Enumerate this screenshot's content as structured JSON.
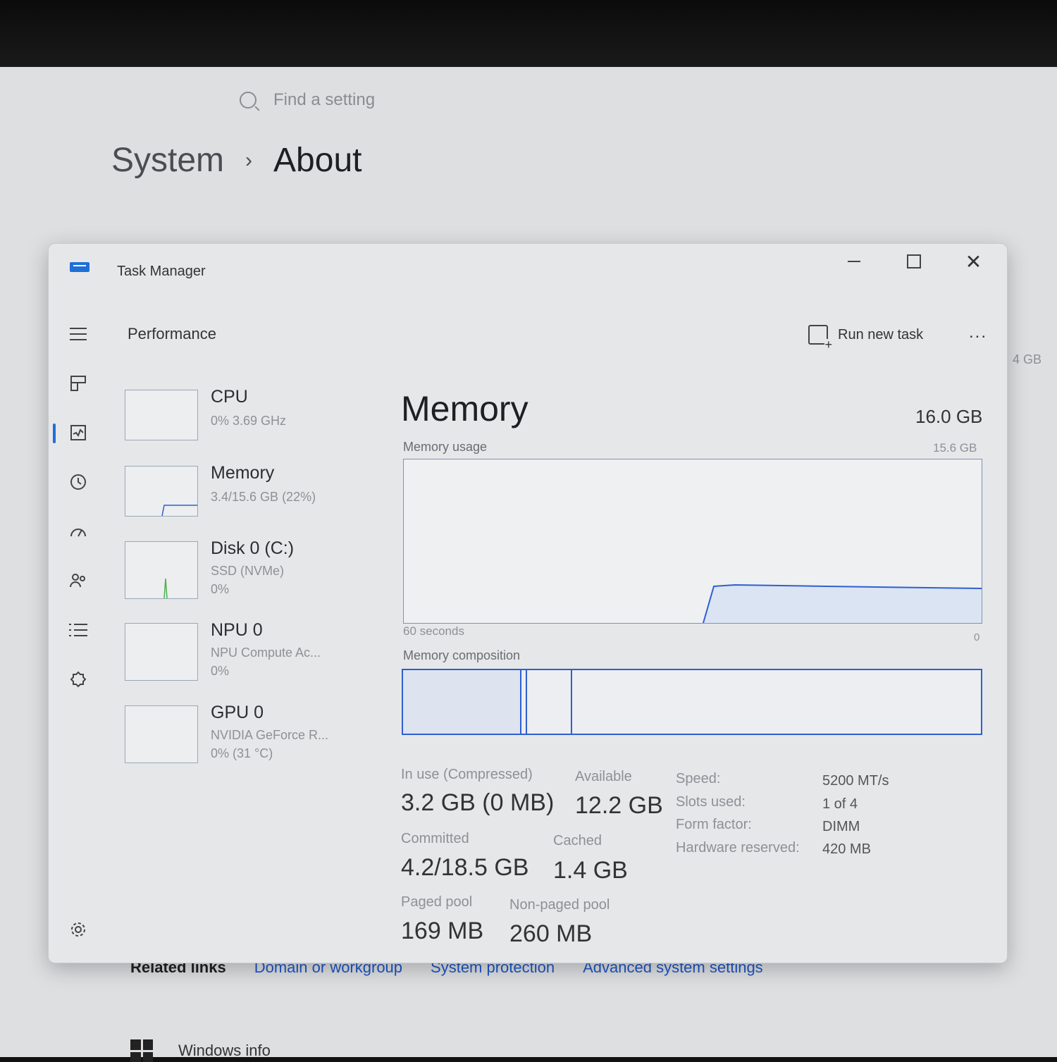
{
  "settings": {
    "search_placeholder": "Find a setting",
    "breadcrumb": {
      "parent": "System",
      "separator": "›",
      "current": "About"
    },
    "related_links": {
      "title": "Related links",
      "links": [
        "Domain or workgroup",
        "System protection",
        "Advanced system settings"
      ]
    },
    "windows_info_label": "Windows info",
    "edge_text": "4 GB"
  },
  "task_manager": {
    "title": "Task Manager",
    "page_title": "Performance",
    "run_new_task_label": "Run new task",
    "more_label": "...",
    "close_glyph": "✕",
    "nav_icons": [
      "menu-icon",
      "processes-icon",
      "performance-icon",
      "app-history-icon",
      "startup-apps-icon",
      "users-icon",
      "details-icon",
      "services-icon",
      "settings-icon"
    ],
    "perf_items": [
      {
        "name": "CPU",
        "sub1": "0% 3.69 GHz",
        "sub2": ""
      },
      {
        "name": "Memory",
        "sub1": "3.4/15.6 GB (22%)",
        "sub2": ""
      },
      {
        "name": "Disk 0 (C:)",
        "sub1": "SSD (NVMe)",
        "sub2": "0%"
      },
      {
        "name": "NPU 0",
        "sub1": "NPU Compute Ac...",
        "sub2": "0%"
      },
      {
        "name": "GPU 0",
        "sub1": "NVIDIA GeForce R...",
        "sub2": "0% (31 °C)"
      }
    ],
    "memory": {
      "title": "Memory",
      "total": "16.0 GB",
      "usage_label": "Memory usage",
      "usage_max": "15.6 GB",
      "time_label": "60 seconds",
      "zero_label": "0",
      "composition_label": "Memory composition",
      "stats": {
        "in_use_label": "In use (Compressed)",
        "in_use_value": "3.2 GB (0 MB)",
        "available_label": "Available",
        "available_value": "12.2 GB",
        "committed_label": "Committed",
        "committed_value": "4.2/18.5 GB",
        "cached_label": "Cached",
        "cached_value": "1.4 GB",
        "paged_label": "Paged pool",
        "paged_value": "169 MB",
        "nonpaged_label": "Non-paged pool",
        "nonpaged_value": "260 MB"
      },
      "specs": [
        {
          "label": "Speed:",
          "value": "5200 MT/s"
        },
        {
          "label": "Slots used:",
          "value": "1 of 4"
        },
        {
          "label": "Form factor:",
          "value": "DIMM"
        },
        {
          "label": "Hardware reserved:",
          "value": "420 MB"
        }
      ]
    }
  },
  "colors": {
    "accent": "#1f6fd6",
    "graph_line": "#2f5fd0",
    "link": "#1d57c6"
  }
}
